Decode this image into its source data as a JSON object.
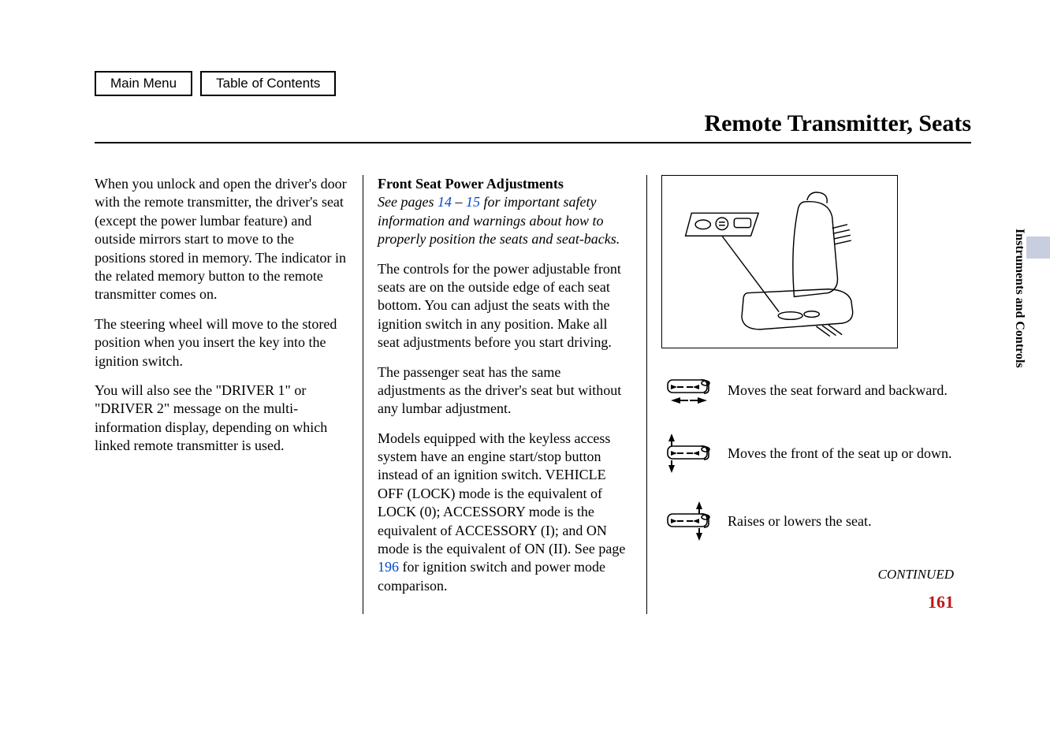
{
  "nav": {
    "main_menu": "Main Menu",
    "toc": "Table of Contents"
  },
  "header_title": "Remote Transmitter, Seats",
  "side_tab": "Instruments and Controls",
  "col1": {
    "p1": "When you unlock and open the driver's door with the remote transmitter, the driver's seat (except the power lumbar feature) and outside mirrors start to move to the positions stored in memory. The indicator in the related memory button to the remote transmitter comes on.",
    "p2": "The steering wheel will move to the stored position when you insert the key into the ignition switch.",
    "p3": "You will also see the \"DRIVER 1\" or \"DRIVER 2\" message on the multi-information display, depending on which linked remote transmitter is used."
  },
  "col2": {
    "heading": "Front Seat Power Adjustments",
    "safety_prefix": "See pages ",
    "safety_link1": "14",
    "safety_dash": " – ",
    "safety_link2": "15",
    "safety_suffix": " for important safety information and warnings about how to properly position the seats and seat-backs.",
    "p1": "The controls for the power adjustable front seats are on the outside edge of each seat bottom. You can adjust the seats with the ignition switch in any position. Make all seat adjustments before you start driving.",
    "p2": "The passenger seat has the same adjustments as the driver's seat but without any lumbar adjustment.",
    "p3_prefix": "Models equipped with the keyless access system have an engine start/stop button instead of an ignition switch. VEHICLE OFF (LOCK) mode is the equivalent of LOCK (0); ACCESSORY mode is the equivalent of ACCESSORY (I); and ON mode is the equivalent of ON (II). See page ",
    "p3_link": "196",
    "p3_suffix": " for ignition switch and power mode comparison."
  },
  "col3": {
    "icon1": "Moves the seat forward and backward.",
    "icon2": "Moves the front of the seat up or down.",
    "icon3": "Raises or lowers the seat."
  },
  "continued": "CONTINUED",
  "page_number": "161"
}
